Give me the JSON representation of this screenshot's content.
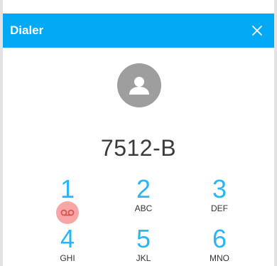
{
  "header": {
    "title": "Dialer",
    "close_icon": "close-icon",
    "accent_color": "#03a9f4"
  },
  "contact": {
    "avatar_icon": "person-icon",
    "number": "7512-B"
  },
  "keypad": {
    "keys": [
      {
        "digit": "1",
        "letters": "",
        "icon": "voicemail-icon"
      },
      {
        "digit": "2",
        "letters": "ABC"
      },
      {
        "digit": "3",
        "letters": "DEF"
      },
      {
        "digit": "4",
        "letters": "GHI"
      },
      {
        "digit": "5",
        "letters": "JKL"
      },
      {
        "digit": "6",
        "letters": "MNO"
      }
    ],
    "digit_color": "#29b6f6"
  }
}
